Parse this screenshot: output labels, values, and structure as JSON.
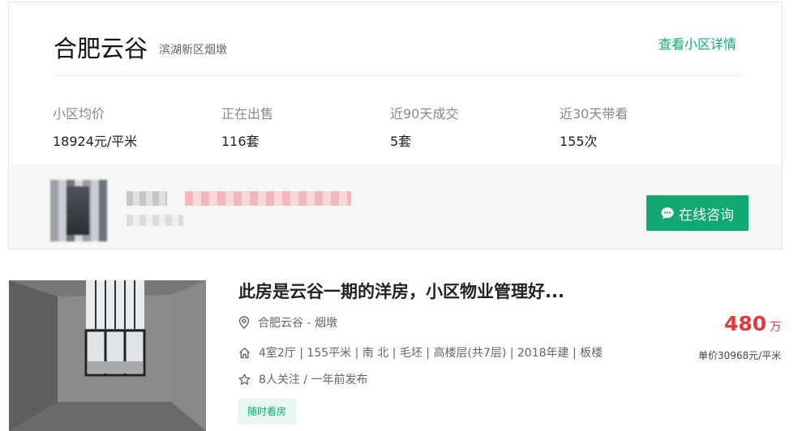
{
  "community": {
    "name": "合肥云谷",
    "district": "滨湖新区烟墩",
    "detail_link": "查看小区详情",
    "stats": [
      {
        "label": "小区均价",
        "value": "18924元/平米"
      },
      {
        "label": "正在出售",
        "value": "116套"
      },
      {
        "label": "近90天成交",
        "value": "5套"
      },
      {
        "label": "近30天带看",
        "value": "155次"
      }
    ]
  },
  "agent": {
    "consult_button": "在线咨询"
  },
  "listing": {
    "title": "此房是云谷一期的洋房，小区物业管理好...",
    "location": "合肥云谷 - 烟墩",
    "info": "4室2厅 | 155平米 | 南 北 | 毛坯 | 高楼层(共7层) | 2018年建 | 板楼",
    "follow": "8人关注 / 一年前发布",
    "price_value": "480",
    "price_unit": "万",
    "unit_price": "单价30968元/平米",
    "tag": "随时看房"
  },
  "colors": {
    "accent": "#10a96f",
    "price": "#e4393c"
  },
  "icons": [
    "location-pin-icon",
    "house-icon",
    "star-icon",
    "chat-bubble-icon"
  ]
}
